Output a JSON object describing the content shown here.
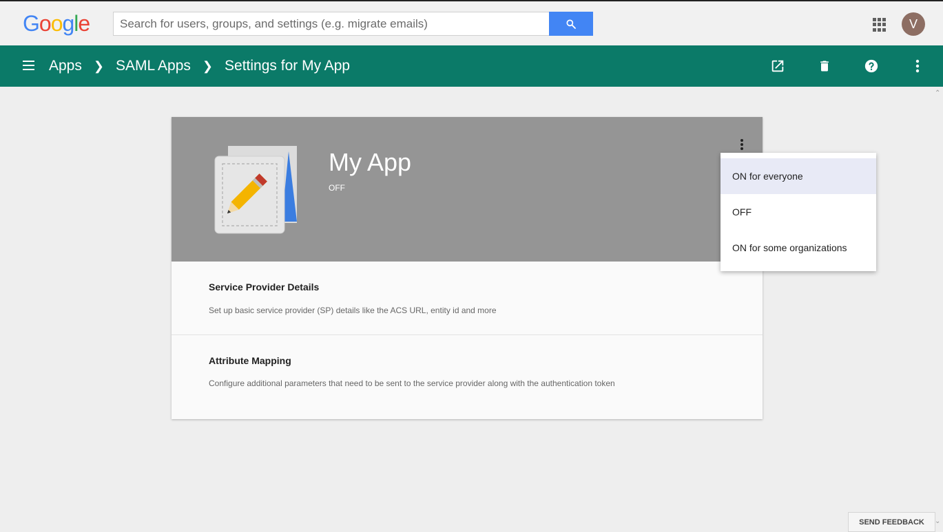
{
  "topbar": {
    "logo_letters": [
      {
        "char": "G",
        "color": "#4285f4"
      },
      {
        "char": "o",
        "color": "#ea4335"
      },
      {
        "char": "o",
        "color": "#fbbc05"
      },
      {
        "char": "g",
        "color": "#4285f4"
      },
      {
        "char": "l",
        "color": "#34a853"
      },
      {
        "char": "e",
        "color": "#ea4335"
      }
    ],
    "search_placeholder": "Search for users, groups, and settings (e.g. migrate emails)",
    "search_icon": "search-icon",
    "apps_icon": "apps-grid-icon",
    "avatar_initial": "V",
    "avatar_color": "#8d6e63"
  },
  "appbar": {
    "color": "#0b7a68",
    "breadcrumbs": [
      "Apps",
      "SAML Apps",
      "Settings for My App"
    ],
    "icons": [
      "open-in-new-icon",
      "delete-icon",
      "help-icon",
      "more-vert-icon"
    ]
  },
  "card": {
    "app_name": "My App",
    "status": "OFF",
    "sections": [
      {
        "title": "Service Provider Details",
        "description": "Set up basic service provider (SP) details like the ACS URL, entity id and more"
      },
      {
        "title": "Attribute Mapping",
        "description": "Configure additional parameters that need to be sent to the service provider along with the authentication token"
      }
    ]
  },
  "dropdown": {
    "items": [
      "ON for everyone",
      "OFF",
      "ON for some organizations"
    ],
    "highlighted_index": 0
  },
  "footer": {
    "feedback_label": "SEND FEEDBACK"
  }
}
